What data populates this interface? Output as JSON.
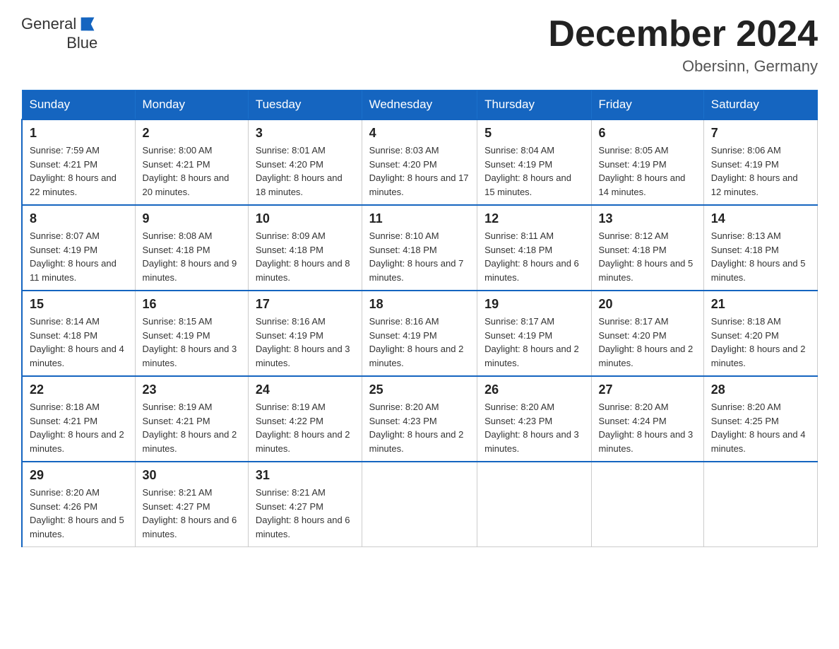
{
  "header": {
    "logo_general": "General",
    "logo_blue": "Blue",
    "month_title": "December 2024",
    "location": "Obersinn, Germany"
  },
  "weekdays": [
    "Sunday",
    "Monday",
    "Tuesday",
    "Wednesday",
    "Thursday",
    "Friday",
    "Saturday"
  ],
  "weeks": [
    [
      {
        "day": "1",
        "sunrise": "7:59 AM",
        "sunset": "4:21 PM",
        "daylight": "8 hours and 22 minutes."
      },
      {
        "day": "2",
        "sunrise": "8:00 AM",
        "sunset": "4:21 PM",
        "daylight": "8 hours and 20 minutes."
      },
      {
        "day": "3",
        "sunrise": "8:01 AM",
        "sunset": "4:20 PM",
        "daylight": "8 hours and 18 minutes."
      },
      {
        "day": "4",
        "sunrise": "8:03 AM",
        "sunset": "4:20 PM",
        "daylight": "8 hours and 17 minutes."
      },
      {
        "day": "5",
        "sunrise": "8:04 AM",
        "sunset": "4:19 PM",
        "daylight": "8 hours and 15 minutes."
      },
      {
        "day": "6",
        "sunrise": "8:05 AM",
        "sunset": "4:19 PM",
        "daylight": "8 hours and 14 minutes."
      },
      {
        "day": "7",
        "sunrise": "8:06 AM",
        "sunset": "4:19 PM",
        "daylight": "8 hours and 12 minutes."
      }
    ],
    [
      {
        "day": "8",
        "sunrise": "8:07 AM",
        "sunset": "4:19 PM",
        "daylight": "8 hours and 11 minutes."
      },
      {
        "day": "9",
        "sunrise": "8:08 AM",
        "sunset": "4:18 PM",
        "daylight": "8 hours and 9 minutes."
      },
      {
        "day": "10",
        "sunrise": "8:09 AM",
        "sunset": "4:18 PM",
        "daylight": "8 hours and 8 minutes."
      },
      {
        "day": "11",
        "sunrise": "8:10 AM",
        "sunset": "4:18 PM",
        "daylight": "8 hours and 7 minutes."
      },
      {
        "day": "12",
        "sunrise": "8:11 AM",
        "sunset": "4:18 PM",
        "daylight": "8 hours and 6 minutes."
      },
      {
        "day": "13",
        "sunrise": "8:12 AM",
        "sunset": "4:18 PM",
        "daylight": "8 hours and 5 minutes."
      },
      {
        "day": "14",
        "sunrise": "8:13 AM",
        "sunset": "4:18 PM",
        "daylight": "8 hours and 5 minutes."
      }
    ],
    [
      {
        "day": "15",
        "sunrise": "8:14 AM",
        "sunset": "4:18 PM",
        "daylight": "8 hours and 4 minutes."
      },
      {
        "day": "16",
        "sunrise": "8:15 AM",
        "sunset": "4:19 PM",
        "daylight": "8 hours and 3 minutes."
      },
      {
        "day": "17",
        "sunrise": "8:16 AM",
        "sunset": "4:19 PM",
        "daylight": "8 hours and 3 minutes."
      },
      {
        "day": "18",
        "sunrise": "8:16 AM",
        "sunset": "4:19 PM",
        "daylight": "8 hours and 2 minutes."
      },
      {
        "day": "19",
        "sunrise": "8:17 AM",
        "sunset": "4:19 PM",
        "daylight": "8 hours and 2 minutes."
      },
      {
        "day": "20",
        "sunrise": "8:17 AM",
        "sunset": "4:20 PM",
        "daylight": "8 hours and 2 minutes."
      },
      {
        "day": "21",
        "sunrise": "8:18 AM",
        "sunset": "4:20 PM",
        "daylight": "8 hours and 2 minutes."
      }
    ],
    [
      {
        "day": "22",
        "sunrise": "8:18 AM",
        "sunset": "4:21 PM",
        "daylight": "8 hours and 2 minutes."
      },
      {
        "day": "23",
        "sunrise": "8:19 AM",
        "sunset": "4:21 PM",
        "daylight": "8 hours and 2 minutes."
      },
      {
        "day": "24",
        "sunrise": "8:19 AM",
        "sunset": "4:22 PM",
        "daylight": "8 hours and 2 minutes."
      },
      {
        "day": "25",
        "sunrise": "8:20 AM",
        "sunset": "4:23 PM",
        "daylight": "8 hours and 2 minutes."
      },
      {
        "day": "26",
        "sunrise": "8:20 AM",
        "sunset": "4:23 PM",
        "daylight": "8 hours and 3 minutes."
      },
      {
        "day": "27",
        "sunrise": "8:20 AM",
        "sunset": "4:24 PM",
        "daylight": "8 hours and 3 minutes."
      },
      {
        "day": "28",
        "sunrise": "8:20 AM",
        "sunset": "4:25 PM",
        "daylight": "8 hours and 4 minutes."
      }
    ],
    [
      {
        "day": "29",
        "sunrise": "8:20 AM",
        "sunset": "4:26 PM",
        "daylight": "8 hours and 5 minutes."
      },
      {
        "day": "30",
        "sunrise": "8:21 AM",
        "sunset": "4:27 PM",
        "daylight": "8 hours and 6 minutes."
      },
      {
        "day": "31",
        "sunrise": "8:21 AM",
        "sunset": "4:27 PM",
        "daylight": "8 hours and 6 minutes."
      },
      null,
      null,
      null,
      null
    ]
  ]
}
